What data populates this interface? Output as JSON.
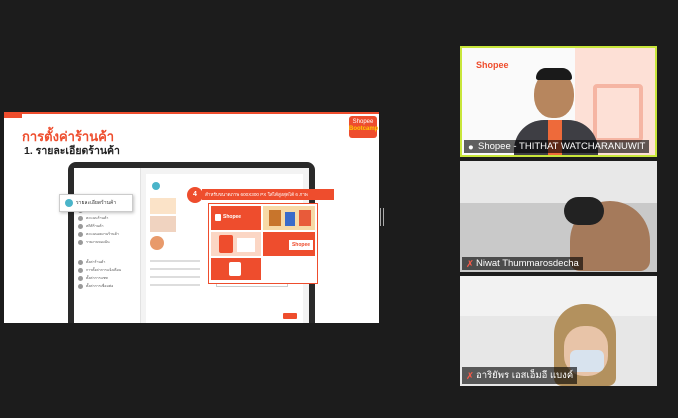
{
  "slide": {
    "title": "การตั้งค่าร้านค้า",
    "subtitle": "1.  รายละเอียดร้านค้า",
    "logo_line1": "Shopee",
    "logo_line2": "Bootcamp",
    "callout_label": "รายละเอียดร้านค้า",
    "step_badge": "4",
    "annotation": "สำหรับขนาดภาพ 600X300 PX ใส่ได้สูงสุดได้ 6 ภาพ",
    "sidebar_items": [
      "รายละเอียดร้านค้า",
      "หมวดหมู่ของร้าน",
      "คะแนนร้านค้า",
      "สถิติร้านค้า",
      "คะแนนผลงานร้านค้า",
      "รายงานของฉัน",
      "ตั้งค่าร้านค้า",
      "การตั้งค่าการแจ้งเตือน",
      "ตั้งค่าการแชท",
      "ตั้งค่าการเชื่อมต่อ"
    ],
    "brand_small": "Shopee"
  },
  "participants": [
    {
      "name": "Shopee - THITHAT WATCHARANUWIT",
      "muted": false,
      "brand": "Shopee"
    },
    {
      "name": "Niwat Thummarosdecha",
      "muted": true
    },
    {
      "name": "อาริยัพร เอสเอ็มอี แบงค์",
      "muted": true
    }
  ],
  "colors": {
    "accent": "#ee4d2d",
    "active_speaker": "#c8e63a"
  }
}
